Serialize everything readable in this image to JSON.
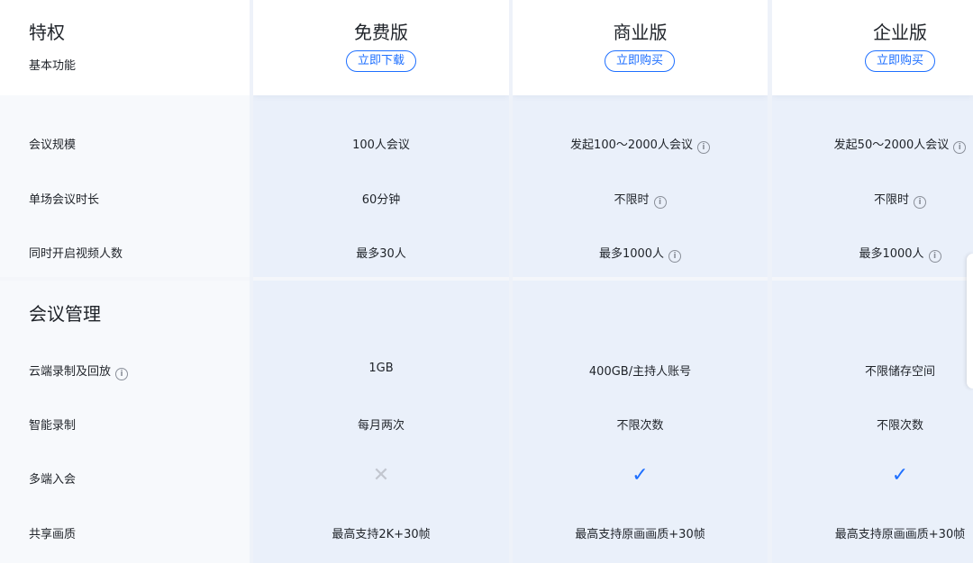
{
  "header": {
    "feature_title": "特权",
    "feature_subtitle": "基本功能",
    "plans": [
      {
        "name": "免费版",
        "button": "立即下载"
      },
      {
        "name": "商业版",
        "button": "立即购买"
      },
      {
        "name": "企业版",
        "button": "立即购买"
      }
    ]
  },
  "basic": {
    "rows": [
      {
        "label": "会议规模",
        "values": [
          "100人会议",
          "发起100～2000人会议",
          "发起50～2000人会议"
        ]
      },
      {
        "label": "单场会议时长",
        "values": [
          "60分钟",
          "不限时",
          "不限时"
        ]
      },
      {
        "label": "同时开启视频人数",
        "values": [
          "最多30人",
          "最多1000人",
          "最多1000人"
        ]
      }
    ]
  },
  "management": {
    "title": "会议管理",
    "rows": [
      {
        "label": "云端录制及回放",
        "values": [
          "1GB",
          "400GB/主持人账号",
          "不限储存空间"
        ]
      },
      {
        "label": "智能录制",
        "values": [
          "每月两次",
          "不限次数",
          "不限次数"
        ]
      },
      {
        "label": "多端入会",
        "values": [
          "✕",
          "✓",
          "✓"
        ]
      },
      {
        "label": "共享画质",
        "values": [
          "最高支持2K+30帧",
          "最高支持原画画质+30帧",
          "最高支持原画画质+30帧"
        ]
      }
    ]
  },
  "icons": {
    "info": "ⓘ",
    "cross": "cross-icon",
    "check": "check-icon"
  },
  "colors": {
    "accent": "#1e6fff",
    "column_bg": "#eaf0fa"
  }
}
